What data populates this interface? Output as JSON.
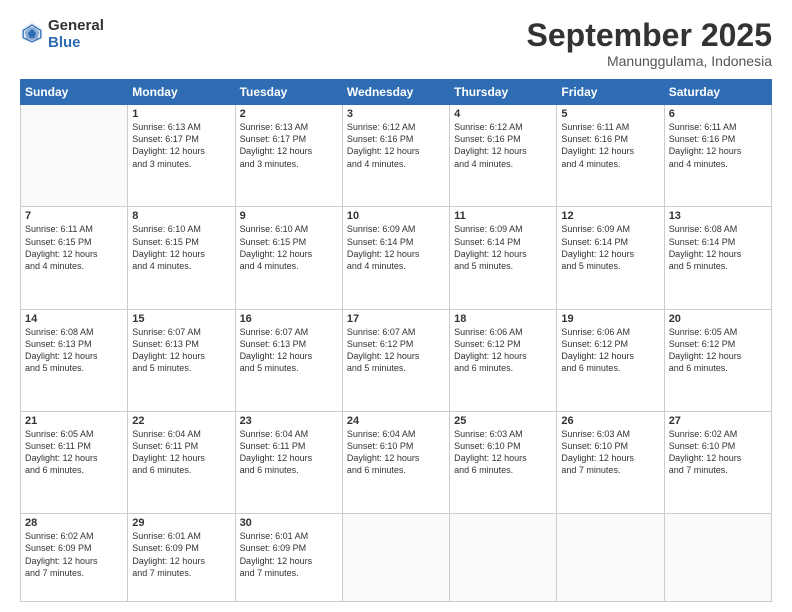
{
  "logo": {
    "general": "General",
    "blue": "Blue"
  },
  "header": {
    "month": "September 2025",
    "location": "Manunggulama, Indonesia"
  },
  "days": [
    "Sunday",
    "Monday",
    "Tuesday",
    "Wednesday",
    "Thursday",
    "Friday",
    "Saturday"
  ],
  "weeks": [
    [
      {
        "day": "",
        "info": ""
      },
      {
        "day": "1",
        "info": "Sunrise: 6:13 AM\nSunset: 6:17 PM\nDaylight: 12 hours\nand 3 minutes."
      },
      {
        "day": "2",
        "info": "Sunrise: 6:13 AM\nSunset: 6:17 PM\nDaylight: 12 hours\nand 3 minutes."
      },
      {
        "day": "3",
        "info": "Sunrise: 6:12 AM\nSunset: 6:16 PM\nDaylight: 12 hours\nand 4 minutes."
      },
      {
        "day": "4",
        "info": "Sunrise: 6:12 AM\nSunset: 6:16 PM\nDaylight: 12 hours\nand 4 minutes."
      },
      {
        "day": "5",
        "info": "Sunrise: 6:11 AM\nSunset: 6:16 PM\nDaylight: 12 hours\nand 4 minutes."
      },
      {
        "day": "6",
        "info": "Sunrise: 6:11 AM\nSunset: 6:16 PM\nDaylight: 12 hours\nand 4 minutes."
      }
    ],
    [
      {
        "day": "7",
        "info": "Sunrise: 6:11 AM\nSunset: 6:15 PM\nDaylight: 12 hours\nand 4 minutes."
      },
      {
        "day": "8",
        "info": "Sunrise: 6:10 AM\nSunset: 6:15 PM\nDaylight: 12 hours\nand 4 minutes."
      },
      {
        "day": "9",
        "info": "Sunrise: 6:10 AM\nSunset: 6:15 PM\nDaylight: 12 hours\nand 4 minutes."
      },
      {
        "day": "10",
        "info": "Sunrise: 6:09 AM\nSunset: 6:14 PM\nDaylight: 12 hours\nand 4 minutes."
      },
      {
        "day": "11",
        "info": "Sunrise: 6:09 AM\nSunset: 6:14 PM\nDaylight: 12 hours\nand 5 minutes."
      },
      {
        "day": "12",
        "info": "Sunrise: 6:09 AM\nSunset: 6:14 PM\nDaylight: 12 hours\nand 5 minutes."
      },
      {
        "day": "13",
        "info": "Sunrise: 6:08 AM\nSunset: 6:14 PM\nDaylight: 12 hours\nand 5 minutes."
      }
    ],
    [
      {
        "day": "14",
        "info": "Sunrise: 6:08 AM\nSunset: 6:13 PM\nDaylight: 12 hours\nand 5 minutes."
      },
      {
        "day": "15",
        "info": "Sunrise: 6:07 AM\nSunset: 6:13 PM\nDaylight: 12 hours\nand 5 minutes."
      },
      {
        "day": "16",
        "info": "Sunrise: 6:07 AM\nSunset: 6:13 PM\nDaylight: 12 hours\nand 5 minutes."
      },
      {
        "day": "17",
        "info": "Sunrise: 6:07 AM\nSunset: 6:12 PM\nDaylight: 12 hours\nand 5 minutes."
      },
      {
        "day": "18",
        "info": "Sunrise: 6:06 AM\nSunset: 6:12 PM\nDaylight: 12 hours\nand 6 minutes."
      },
      {
        "day": "19",
        "info": "Sunrise: 6:06 AM\nSunset: 6:12 PM\nDaylight: 12 hours\nand 6 minutes."
      },
      {
        "day": "20",
        "info": "Sunrise: 6:05 AM\nSunset: 6:12 PM\nDaylight: 12 hours\nand 6 minutes."
      }
    ],
    [
      {
        "day": "21",
        "info": "Sunrise: 6:05 AM\nSunset: 6:11 PM\nDaylight: 12 hours\nand 6 minutes."
      },
      {
        "day": "22",
        "info": "Sunrise: 6:04 AM\nSunset: 6:11 PM\nDaylight: 12 hours\nand 6 minutes."
      },
      {
        "day": "23",
        "info": "Sunrise: 6:04 AM\nSunset: 6:11 PM\nDaylight: 12 hours\nand 6 minutes."
      },
      {
        "day": "24",
        "info": "Sunrise: 6:04 AM\nSunset: 6:10 PM\nDaylight: 12 hours\nand 6 minutes."
      },
      {
        "day": "25",
        "info": "Sunrise: 6:03 AM\nSunset: 6:10 PM\nDaylight: 12 hours\nand 6 minutes."
      },
      {
        "day": "26",
        "info": "Sunrise: 6:03 AM\nSunset: 6:10 PM\nDaylight: 12 hours\nand 7 minutes."
      },
      {
        "day": "27",
        "info": "Sunrise: 6:02 AM\nSunset: 6:10 PM\nDaylight: 12 hours\nand 7 minutes."
      }
    ],
    [
      {
        "day": "28",
        "info": "Sunrise: 6:02 AM\nSunset: 6:09 PM\nDaylight: 12 hours\nand 7 minutes."
      },
      {
        "day": "29",
        "info": "Sunrise: 6:01 AM\nSunset: 6:09 PM\nDaylight: 12 hours\nand 7 minutes."
      },
      {
        "day": "30",
        "info": "Sunrise: 6:01 AM\nSunset: 6:09 PM\nDaylight: 12 hours\nand 7 minutes."
      },
      {
        "day": "",
        "info": ""
      },
      {
        "day": "",
        "info": ""
      },
      {
        "day": "",
        "info": ""
      },
      {
        "day": "",
        "info": ""
      }
    ]
  ]
}
